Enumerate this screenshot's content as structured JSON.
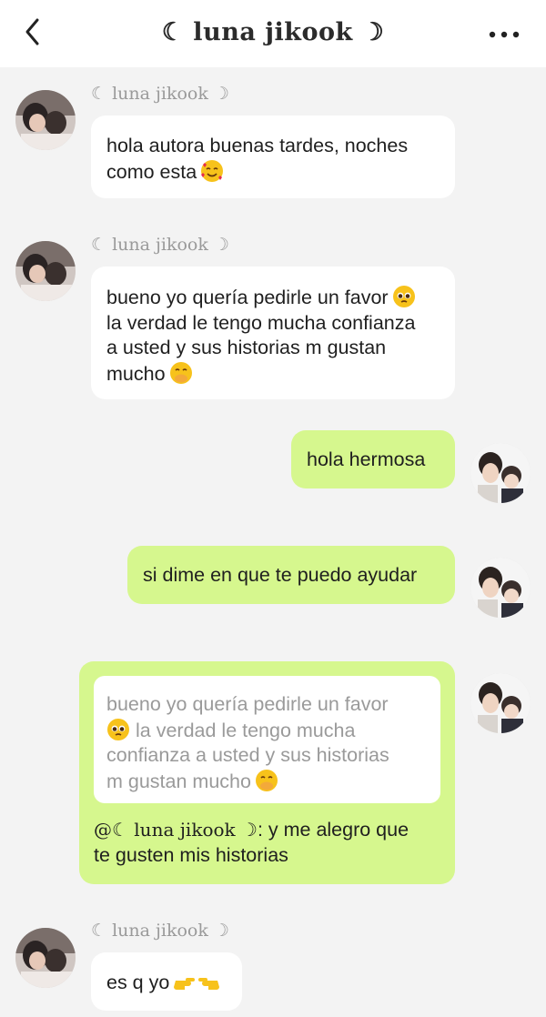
{
  "header": {
    "title": "☾ luna jikook ☽",
    "back_icon": "chevron-left-icon",
    "more_icon": "more-dots-icon"
  },
  "colors": {
    "background": "#f3f3f3",
    "incoming_bubble": "#ffffff",
    "outgoing_bubble": "#d6f78e",
    "sender_name": "#9a9a9a"
  },
  "messages": [
    {
      "direction": "incoming",
      "sender": "☾ luna jikook ☽",
      "lines": [
        "hola autora buenas tardes, noches",
        "como esta"
      ],
      "emoji": "smiling-face-with-hearts-emoji"
    },
    {
      "direction": "incoming",
      "sender": "☾ luna jikook ☽",
      "lines": [
        "bueno yo quería pedirle un favor",
        "la verdad le tengo mucha confianza",
        "a usted y sus historias m gustan",
        "mucho"
      ],
      "emoji": "pleading-face-emoji",
      "emoji2": "face-with-hand-over-mouth-emoji"
    },
    {
      "direction": "outgoing",
      "text": "hola hermosa"
    },
    {
      "direction": "outgoing",
      "text": "si dime en que te puedo ayudar"
    },
    {
      "direction": "outgoing",
      "quote_lines": [
        "bueno yo quería pedirle un favor",
        "la verdad le tengo mucha",
        "confianza a usted y sus historias",
        "m gustan mucho"
      ],
      "mention": "@☾ luna jikook ☽",
      "reply_suffix": ": y me alegro que",
      "reply_line2": "te gusten mis historias"
    },
    {
      "direction": "incoming",
      "sender": "☾ luna jikook ☽",
      "text": "es q yo",
      "emoji": "backhand-index-pointing-right-and-left-emoji"
    }
  ]
}
